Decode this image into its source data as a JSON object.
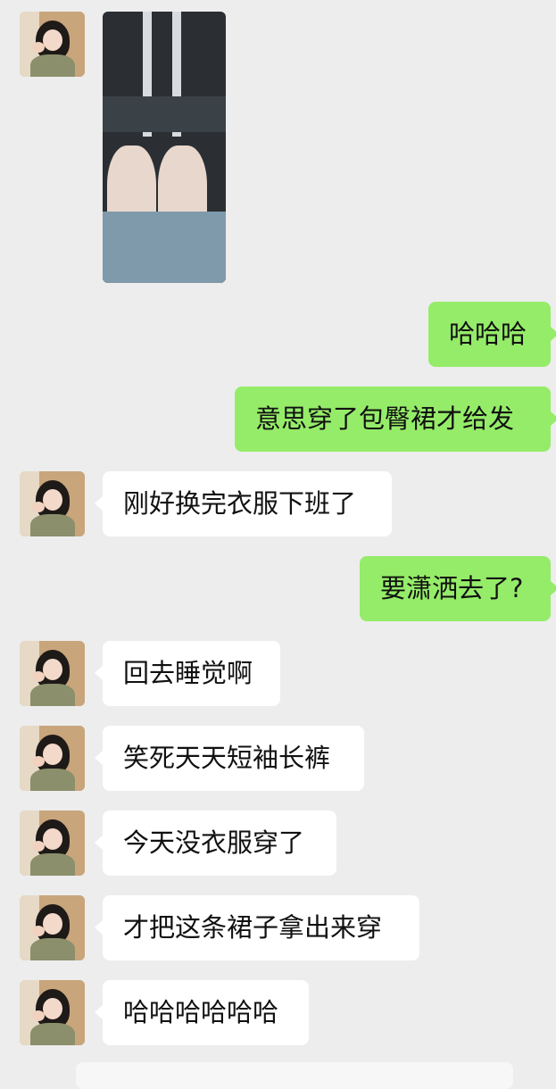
{
  "chat": {
    "messages": [
      {
        "side": "in",
        "text": "刚好换完衣服下班了"
      },
      {
        "side": "out",
        "text": "哈哈哈"
      },
      {
        "side": "out",
        "text": "意思穿了包臀裙才给发"
      },
      {
        "side": "in",
        "text": "刚好换完衣服下班了"
      },
      {
        "side": "out",
        "text": "要潇洒去了?"
      },
      {
        "side": "in",
        "text": "回去睡觉啊"
      },
      {
        "side": "in",
        "text": "笑死天天短袖长裤"
      },
      {
        "side": "in",
        "text": "今天没衣服穿了"
      },
      {
        "side": "in",
        "text": "才把这条裙子拿出来穿"
      },
      {
        "side": "in",
        "text": "哈哈哈哈哈哈"
      }
    ]
  },
  "colors": {
    "background": "#ededed",
    "incoming_bubble": "#ffffff",
    "outgoing_bubble": "#95ec69"
  }
}
